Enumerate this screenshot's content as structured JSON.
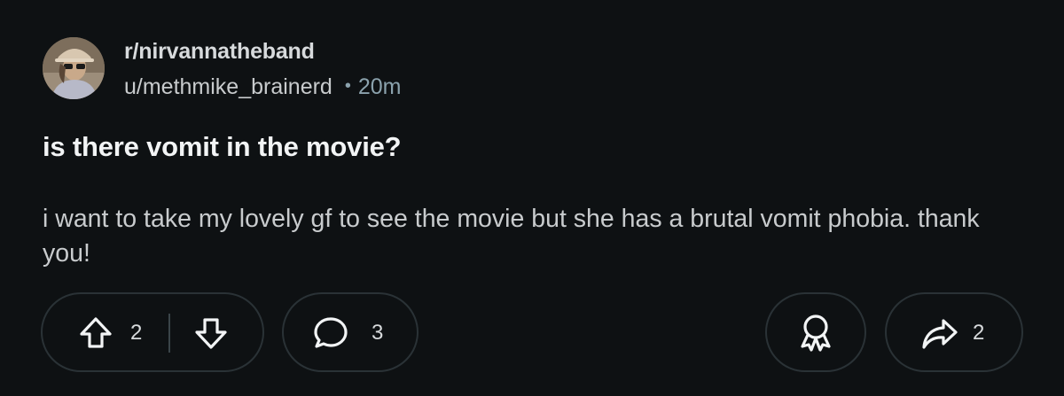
{
  "post": {
    "subreddit": "r/nirvannatheband",
    "author": "u/methmike_brainerd",
    "separator": "•",
    "age": "20m",
    "title": "is there vomit in the movie?",
    "body": "i want to take my lovely gf to see the movie but she has a brutal vomit phobia. thank you!"
  },
  "actions": {
    "upvote_count": "2",
    "comment_count": "3",
    "share_count": "2",
    "icons": {
      "upvote": "arrow-up-icon",
      "downvote": "arrow-down-icon",
      "comment": "speech-bubble-icon",
      "award": "award-ribbon-icon",
      "share": "share-arrow-icon"
    }
  },
  "colors": {
    "background": "#0e1113",
    "pill_border": "#2a3236",
    "muted_text": "#8ba2ad",
    "primary_text": "#f2f4f5"
  }
}
